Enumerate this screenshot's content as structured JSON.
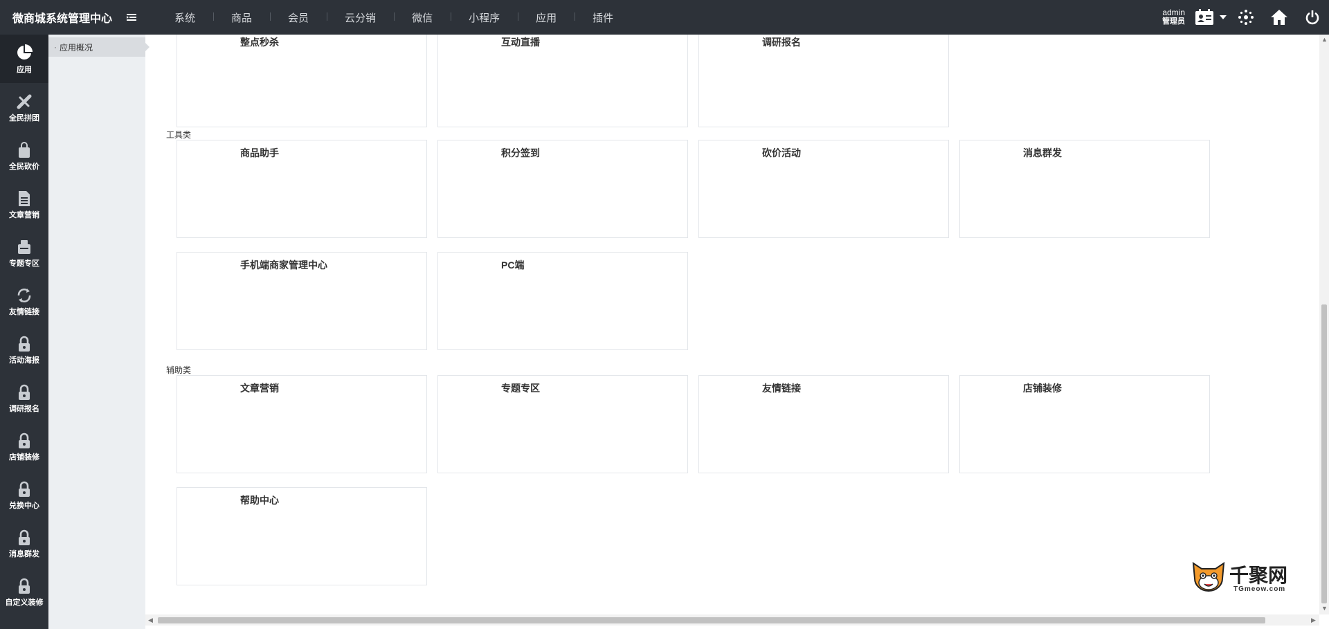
{
  "app": {
    "title": "微商城系统管理中心"
  },
  "topnav": {
    "items": [
      "系统",
      "商品",
      "会员",
      "云分销",
      "微信",
      "小程序",
      "应用",
      "插件"
    ]
  },
  "user": {
    "name": "admin",
    "role": "管理员"
  },
  "sidebar": {
    "items": [
      {
        "label": "应用",
        "icon": "pie-chart-icon",
        "active": true
      },
      {
        "label": "全民拼团",
        "icon": "group-buy-icon"
      },
      {
        "label": "全民砍价",
        "icon": "shopping-bag-icon"
      },
      {
        "label": "文章营销",
        "icon": "document-icon"
      },
      {
        "label": "专题专区",
        "icon": "topic-icon"
      },
      {
        "label": "友情链接",
        "icon": "refresh-link-icon"
      },
      {
        "label": "活动海报",
        "icon": "lock-icon"
      },
      {
        "label": "调研报名",
        "icon": "lock-icon"
      },
      {
        "label": "店铺装修",
        "icon": "lock-icon"
      },
      {
        "label": "兑换中心",
        "icon": "lock-icon"
      },
      {
        "label": "消息群发",
        "icon": "lock-icon"
      },
      {
        "label": "自定义装修",
        "icon": "lock-icon"
      }
    ]
  },
  "subside": {
    "items": [
      "应用概况"
    ]
  },
  "sections": {
    "top_cards": [
      "整点秒杀",
      "互动直播",
      "调研报名"
    ],
    "tools": {
      "label": "工具类",
      "cards": [
        "商品助手",
        "积分签到",
        "砍价活动",
        "消息群发",
        "手机端商家管理中心",
        "PC端"
      ]
    },
    "aux": {
      "label": "辅助类",
      "cards": [
        "文章营销",
        "专题专区",
        "友情链接",
        "店铺装修",
        "帮助中心"
      ]
    }
  },
  "watermark": {
    "title": "千聚网",
    "sub": "TGmeow.com"
  },
  "colors": {
    "topbar": "#2d3239",
    "sidebar": "#2d3239",
    "subside": "#eceff2",
    "card_border": "#e3e6ea"
  }
}
